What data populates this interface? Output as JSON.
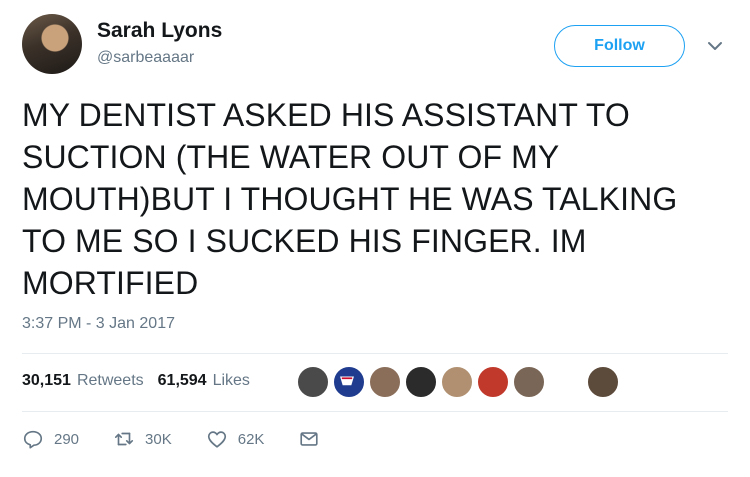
{
  "user": {
    "display_name": "Sarah Lyons",
    "handle": "@sarbeaaaar",
    "avatar": "profile-photo"
  },
  "follow_label": "Follow",
  "tweet": {
    "text": "MY DENTIST ASKED HIS ASSISTANT TO\nSUCTION (THE WATER OUT OF MY\nMOUTH)BUT I THOUGHT HE WAS TALKING\nTO ME SO I SUCKED HIS FINGER. IM\nMORTIFIED",
    "timestamp": "3:37 PM - 3 Jan 2017"
  },
  "stats": {
    "retweets_count": "30,151",
    "retweets_label": "Retweets",
    "likes_count": "61,594",
    "likes_label": "Likes"
  },
  "likers": [
    {
      "icon": "avatar",
      "color": "#4a4a4a"
    },
    {
      "icon": "rangers-logo",
      "color": "#1f3c8f"
    },
    {
      "icon": "avatar",
      "color": "#8a6e5a"
    },
    {
      "icon": "avatar",
      "color": "#2b2b2b"
    },
    {
      "icon": "avatar",
      "color": "#b09070"
    },
    {
      "icon": "avatar",
      "color": "#c0392b"
    },
    {
      "icon": "avatar",
      "color": "#7a6656"
    },
    {
      "icon": "avatar",
      "color": "#5c4a3a"
    }
  ],
  "actions": {
    "reply_count": "290",
    "retweet_count": "30K",
    "like_count": "62K"
  },
  "icons": {
    "caret": "chevron-down-icon",
    "reply": "reply-icon",
    "retweet": "retweet-icon",
    "like": "heart-icon",
    "dm": "envelope-icon"
  }
}
